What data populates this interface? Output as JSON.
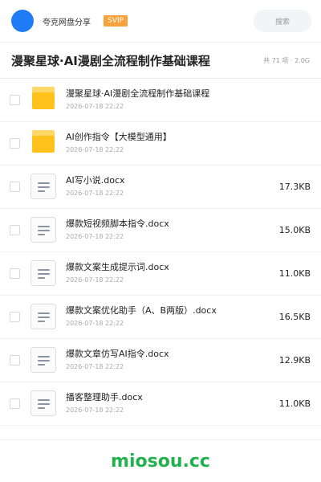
{
  "header": {
    "user_name": "夸克网盘分享",
    "badge": "SVIP",
    "search_placeholder": "搜索"
  },
  "folder": {
    "title": "漫聚星球·AI漫剧全流程制作基础课程",
    "meta": "共 71 项 · 2.0G"
  },
  "items": [
    {
      "type": "folder",
      "icon": "folder-icon",
      "name": "漫聚星球·AI漫剧全流程制作基础课程",
      "date": "2026-07-18 22:22",
      "size": ""
    },
    {
      "type": "folder",
      "icon": "folder-icon",
      "name": "AI创作指令【大模型通用】",
      "date": "2026-07-18 22:22",
      "size": ""
    },
    {
      "type": "file",
      "icon": "doc-icon",
      "name": "AI写小说.docx",
      "date": "2026-07-18 22:22",
      "size": "17.3KB"
    },
    {
      "type": "file",
      "icon": "doc-icon",
      "name": "爆款短视频脚本指令.docx",
      "date": "2026-07-18 22:22",
      "size": "15.0KB"
    },
    {
      "type": "file",
      "icon": "doc-icon",
      "name": "爆款文案生成提示词.docx",
      "date": "2026-07-18 22:22",
      "size": "11.0KB"
    },
    {
      "type": "file",
      "icon": "doc-icon",
      "name": "爆款文案优化助手（A、B两版）.docx",
      "date": "2026-07-18 22:22",
      "size": "16.5KB"
    },
    {
      "type": "file",
      "icon": "doc-icon",
      "name": "爆款文章仿写AI指令.docx",
      "date": "2026-07-18 22:22",
      "size": "12.9KB"
    },
    {
      "type": "file",
      "icon": "doc-icon",
      "name": "播客整理助手.docx",
      "date": "2026-07-18 22:22",
      "size": "11.0KB"
    }
  ],
  "watermark": "miosou.cc",
  "colors": {
    "avatar": "#1f7cf6",
    "badge": "#f7a23b",
    "folder": "#ffc21c",
    "watermark": "#23b14d"
  }
}
